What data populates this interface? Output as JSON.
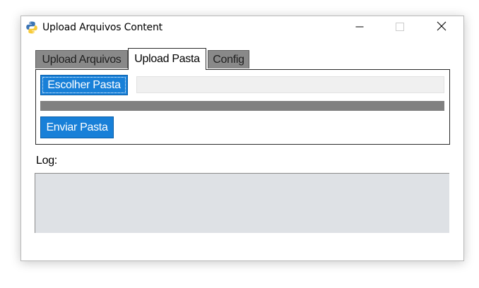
{
  "window": {
    "title": "Upload Arquivos Content",
    "icon": "python-icon"
  },
  "window_controls": {
    "minimize_icon": "minimize-icon",
    "maximize_icon": "maximize-icon",
    "close_icon": "close-icon"
  },
  "tabs": [
    {
      "label": "Upload Arquivos",
      "active": false
    },
    {
      "label": "Upload Pasta",
      "active": true
    },
    {
      "label": "Config",
      "active": false
    }
  ],
  "upload_pasta": {
    "choose_button_label": "Escolher Pasta",
    "folder_path_value": "",
    "progress": 0,
    "send_button_label": "Enviar Pasta"
  },
  "log": {
    "label": "Log:",
    "content": ""
  },
  "colors": {
    "button_blue": "#1880d8",
    "inactive_tab": "#898989",
    "progress_track": "#808080",
    "log_background": "#dee1e5"
  }
}
